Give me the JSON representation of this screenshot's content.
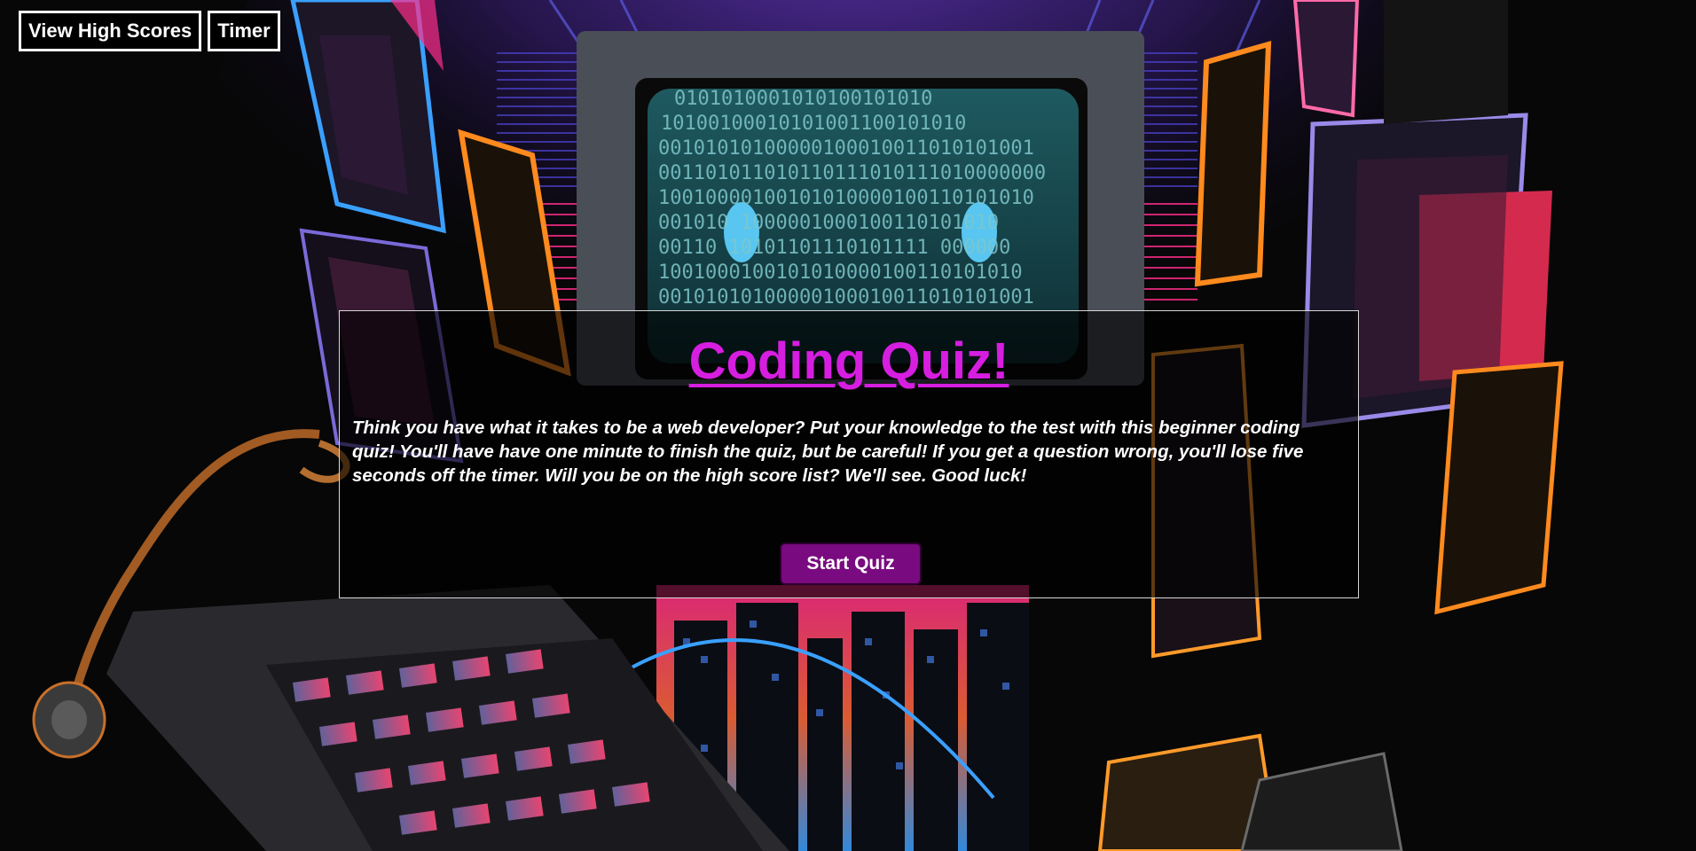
{
  "header": {
    "high_scores_label": "View High Scores",
    "timer_label": "Timer"
  },
  "quiz": {
    "title": "Coding Quiz!",
    "description": "Think you have what it takes to be a web developer? Put your knowledge to the test with this beginner coding quiz! You'll have have one minute to finish the quiz, but be careful! If you get a question wrong, you'll lose five seconds off the timer. Will you be on the high score list? We'll see. Good luck!",
    "start_label": "Start Quiz"
  },
  "colors": {
    "title": "#d61ee0",
    "start_button": "#7a0a7f",
    "monitor_code": "#7fc7cc",
    "monitor_eyes": "#58c6f0",
    "neon_pink": "#ff2d8a",
    "neon_blue": "#3aa0ff",
    "neon_orange": "#ff8a1e"
  },
  "background": {
    "description_icon": "retro-computer-art",
    "monitor_code_lines": [
      "0101010001010100101010",
      "10100100010101001100101010",
      "00101010100000100010011010101001",
      "001101011010110111010111010000000",
      "10010000100101010000100110101010",
      "001010 1000001000100110101010",
      "00110 10101101110101111 000000",
      "1001000100101010000100110101010",
      "00101010100000100010011010101001"
    ]
  }
}
